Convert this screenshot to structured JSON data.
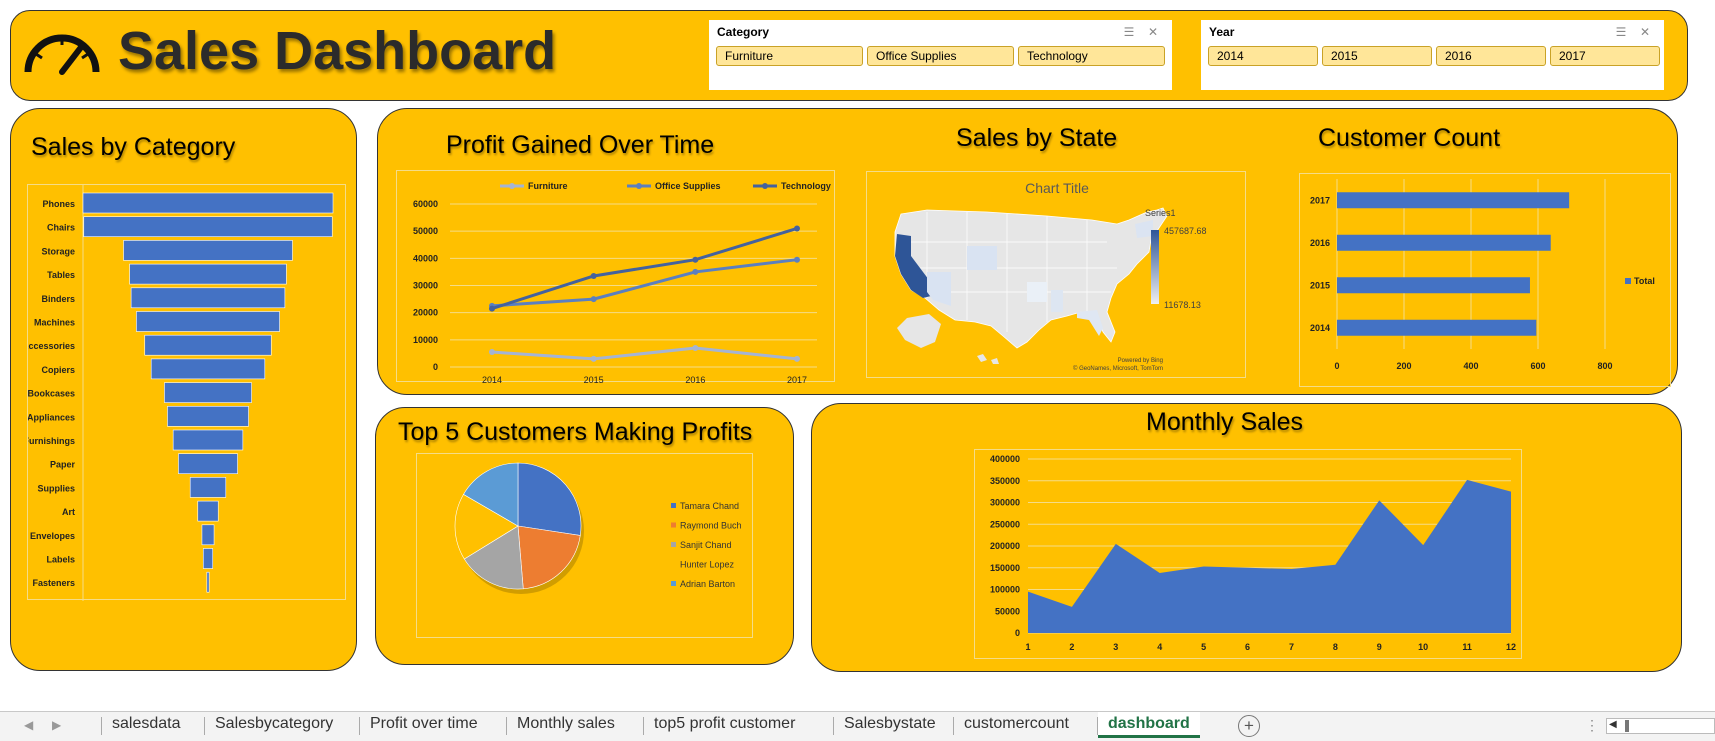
{
  "header": {
    "title": "Sales Dashboard",
    "icon": "speedometer-icon"
  },
  "slicers": {
    "category": {
      "title": "Category",
      "items": [
        "Furniture",
        "Office Supplies",
        "Technology"
      ]
    },
    "year": {
      "title": "Year",
      "items": [
        "2014",
        "2015",
        "2016",
        "2017"
      ]
    }
  },
  "panels": {
    "sales_by_category": "Sales by Category",
    "profit_over_time": "Profit Gained Over Time",
    "sales_by_state": "Sales by State",
    "customer_count": "Customer Count",
    "top5": "Top 5 Customers Making Profits",
    "monthly_sales": "Monthly Sales"
  },
  "map": {
    "title": "Chart Title",
    "legend_series": "Series1",
    "legend_max": "457687.68",
    "legend_min": "11678.13",
    "credit_1": "Powered by Bing",
    "credit_2": "© GeoNames, Microsoft, TomTom",
    "colors": {
      "low": "#dce6f2",
      "high": "#2e5597"
    }
  },
  "chart_data": [
    {
      "type": "bar",
      "orientation": "horizontal-funnel",
      "categories": [
        "Phones",
        "Chairs",
        "Storage",
        "Tables",
        "Binders",
        "Machines",
        "Accessories",
        "Copiers",
        "Bookcases",
        "Appliances",
        "Furnishings",
        "Paper",
        "Supplies",
        "Art",
        "Envelopes",
        "Labels",
        "Fasteners"
      ],
      "values": [
        330000,
        328000,
        223000,
        207000,
        203000,
        189000,
        167000,
        150000,
        115000,
        107000,
        92000,
        78000,
        47000,
        27000,
        16000,
        12500,
        3000
      ],
      "colors": {
        "bar": "#4472c4"
      }
    },
    {
      "type": "line",
      "categories": [
        "2014",
        "2015",
        "2016",
        "2017"
      ],
      "ylim": [
        0,
        60000
      ],
      "yticks": [
        0,
        10000,
        20000,
        30000,
        40000,
        50000,
        60000
      ],
      "series": [
        {
          "name": "Furniture",
          "values": [
            5500,
            3000,
            7000,
            3000
          ],
          "color": "#a5b4d3"
        },
        {
          "name": "Office Supplies",
          "values": [
            22500,
            25000,
            35000,
            39500
          ],
          "color": "#5b7fc0"
        },
        {
          "name": "Technology",
          "values": [
            21500,
            33500,
            39500,
            51000
          ],
          "color": "#44629e"
        }
      ]
    },
    {
      "type": "bar",
      "orientation": "horizontal",
      "categories": [
        "2017",
        "2016",
        "2015",
        "2014"
      ],
      "values": [
        693,
        638,
        576,
        595
      ],
      "xlim": [
        0,
        800
      ],
      "xticks": [
        0,
        200,
        400,
        600,
        800
      ],
      "legend": "Total",
      "colors": {
        "bar": "#4472c4"
      }
    },
    {
      "type": "pie",
      "labels": [
        "Tamara Chand",
        "Raymond Buch",
        "Sanjit Chand",
        "Hunter Lopez",
        "Adrian Barton"
      ],
      "values": [
        8981,
        6976,
        5757,
        5622,
        5449
      ],
      "colors": [
        "#4472c4",
        "#ed7d31",
        "#a5a5a5",
        "#ffc000",
        "#5b9bd5"
      ]
    },
    {
      "type": "area",
      "categories": [
        "1",
        "2",
        "3",
        "4",
        "5",
        "6",
        "7",
        "8",
        "9",
        "10",
        "11",
        "12"
      ],
      "values": [
        95000,
        60000,
        205000,
        138000,
        153000,
        150000,
        147000,
        157000,
        305000,
        202000,
        352000,
        325000
      ],
      "ylim": [
        0,
        400000
      ],
      "yticks": [
        0,
        50000,
        100000,
        150000,
        200000,
        250000,
        300000,
        350000,
        400000
      ],
      "colors": {
        "fill": "#4472c4"
      }
    }
  ],
  "sheet_tabs": [
    "salesdata",
    "Salesbycategory",
    "Profit over time",
    "Monthly sales",
    "top5 profit customer",
    "Salesbystate",
    "customercount",
    "dashboard"
  ],
  "active_tab": "dashboard"
}
